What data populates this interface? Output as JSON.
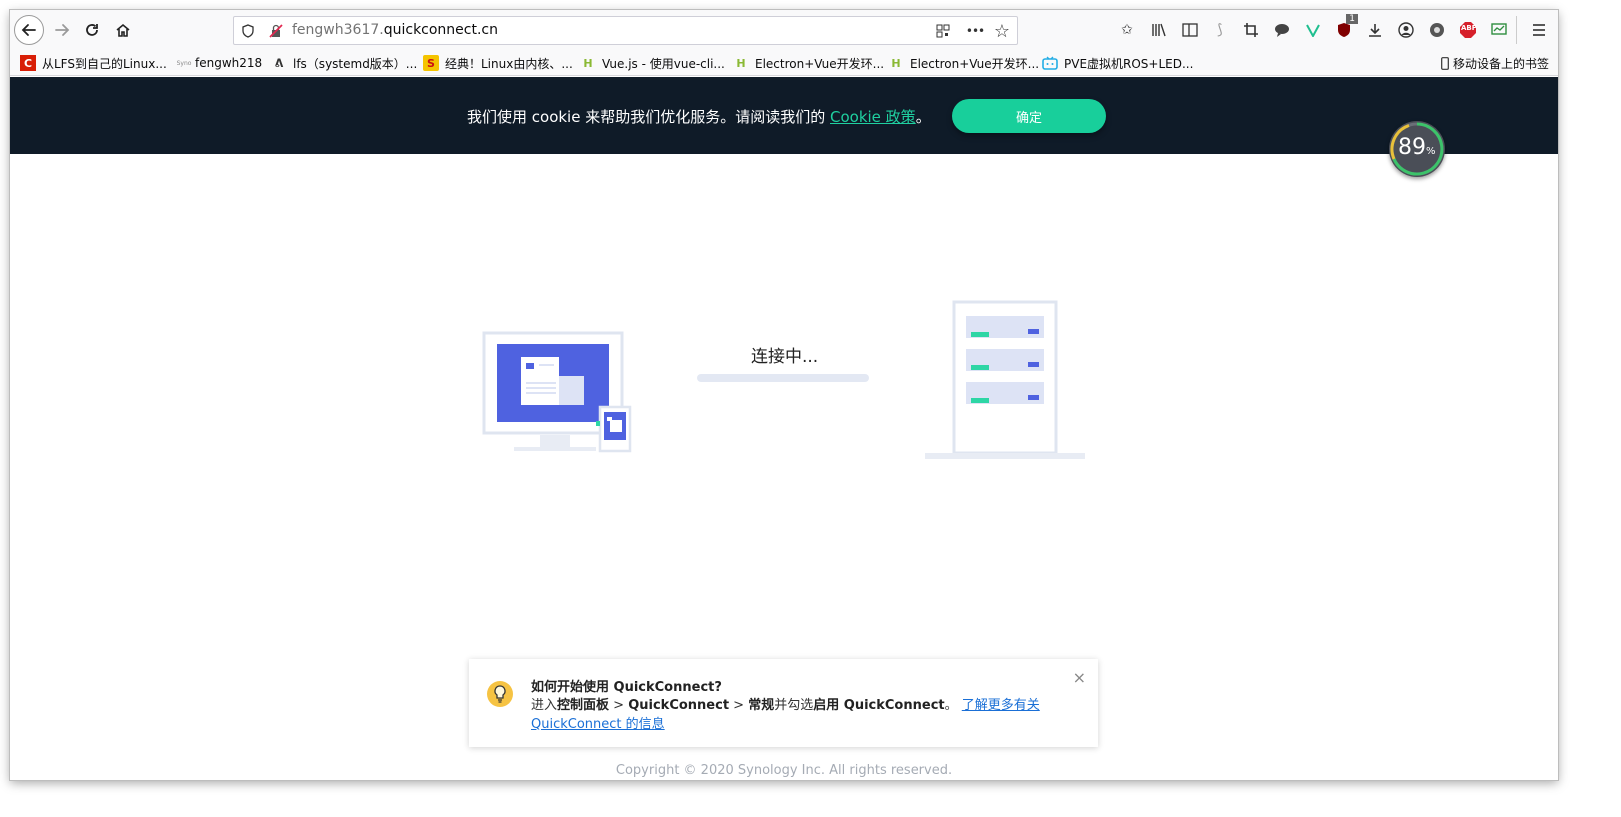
{
  "browser": {
    "url_prefix": "fengwh3617.",
    "url_domain": "quickconnect.cn",
    "more_glyph": "•••",
    "ublock_badge": "1",
    "abp_label": "ABP"
  },
  "bookmarks": [
    {
      "label": "从LFS到自己的Linux...",
      "icon": "C"
    },
    {
      "label": "fengwh218",
      "icon": "Syno"
    },
    {
      "label": "lfs（systemd版本）...",
      "icon": "ᕕ"
    },
    {
      "label": "经典！Linux由内核、...",
      "icon": "S"
    },
    {
      "label": "Vue.js - 使用vue-cli...",
      "icon": "H"
    },
    {
      "label": "Electron+Vue开发环...",
      "icon": "H"
    },
    {
      "label": "Electron+Vue开发环...",
      "icon": "H"
    },
    {
      "label": "PVE虚拟机ROS+LED...",
      "icon": "tv"
    }
  ],
  "mobile_bookmarks": "移动设备上的书签",
  "cookie": {
    "text": "我们使用 cookie 来帮助我们优化服务。请阅读我们的 ",
    "link": "Cookie 政策",
    "suffix": "。",
    "button": "确定"
  },
  "speed_widget": {
    "value": "89",
    "unit": "%"
  },
  "connecting": {
    "label": "连接中..."
  },
  "tip": {
    "title": "如何开始使用 QuickConnect?",
    "part1": "进入",
    "control_panel": "控制面板",
    "sep1": " > ",
    "qc1": "QuickConnect",
    "sep2": " > ",
    "general": "常规",
    "part2": "并勾选",
    "enable": "启用 QuickConnect",
    "part3": "。 ",
    "link": "了解更多有关 QuickConnect 的信息",
    "close": "×"
  },
  "copyright": "Copyright © 2020 Synology Inc. All rights reserved.",
  "colors": {
    "cookie_bg": "#0f1b28",
    "accent_green": "#18cf9b",
    "illustration_blue": "#4f62e0",
    "link_blue": "#1a6fd6"
  }
}
